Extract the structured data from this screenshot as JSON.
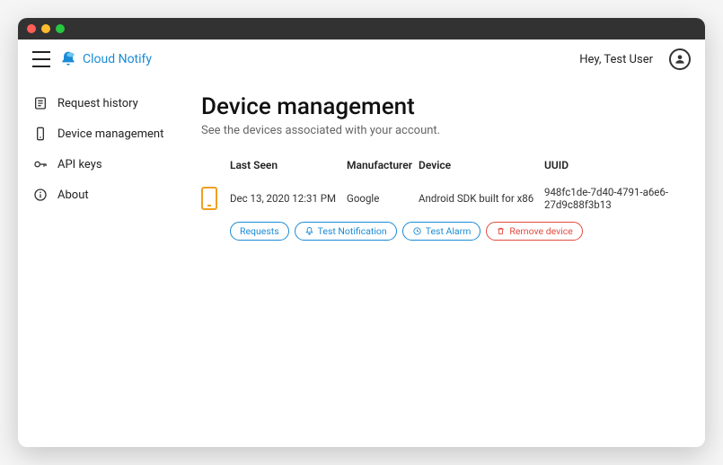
{
  "app": {
    "name": "Cloud Notify",
    "greeting": "Hey, Test User"
  },
  "sidebar": {
    "items": [
      {
        "label": "Request history"
      },
      {
        "label": "Device management"
      },
      {
        "label": "API keys"
      },
      {
        "label": "About"
      }
    ]
  },
  "page": {
    "title": "Device management",
    "subtitle": "See the devices associated with your account."
  },
  "table": {
    "headers": {
      "last_seen": "Last Seen",
      "manufacturer": "Manufacturer",
      "device": "Device",
      "uuid": "UUID"
    },
    "rows": [
      {
        "last_seen": "Dec 13, 2020 12:31 PM",
        "manufacturer": "Google",
        "device": "Android SDK built for x86",
        "uuid": "948fc1de-7d40-4791-a6e6-27d9c88f3b13"
      }
    ]
  },
  "actions": {
    "requests": "Requests",
    "test_notification": "Test Notification",
    "test_alarm": "Test Alarm",
    "remove_device": "Remove device"
  }
}
